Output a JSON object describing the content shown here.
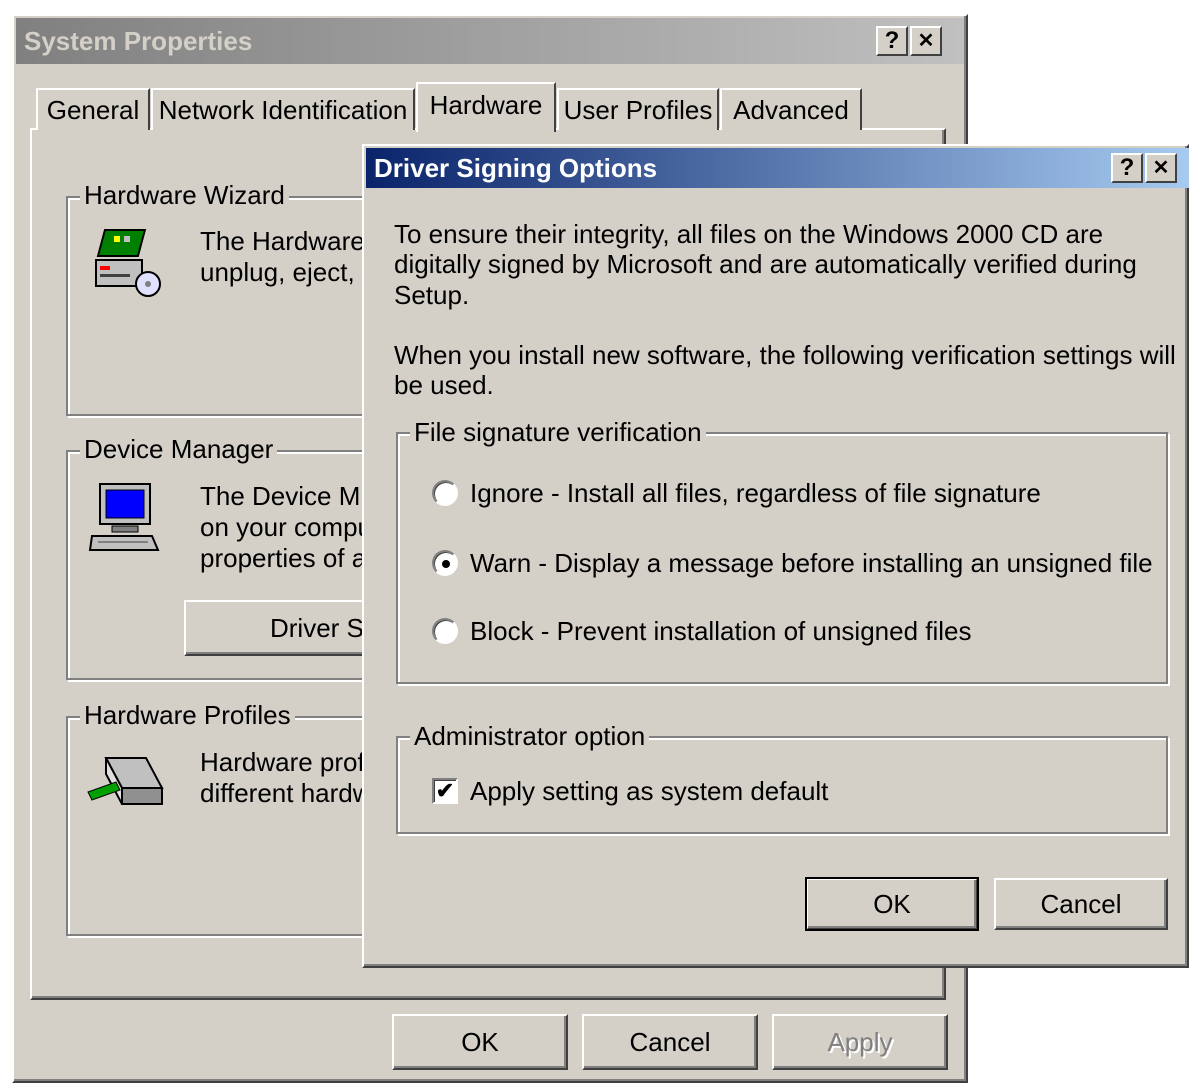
{
  "system_properties": {
    "title": "System Properties",
    "help_button": "?",
    "close_button": "✕",
    "tabs": [
      {
        "label": "General"
      },
      {
        "label": "Network Identification"
      },
      {
        "label": "Hardware"
      },
      {
        "label": "User Profiles"
      },
      {
        "label": "Advanced"
      }
    ],
    "active_tab": "Hardware",
    "hardware_wizard": {
      "legend": "Hardware Wizard",
      "line1": "The Hardware",
      "line2": "unplug, eject, a"
    },
    "device_manager": {
      "legend": "Device Manager",
      "line1": "The Device M",
      "line2": "on your compu",
      "line3": "properties of ar",
      "driver_signing_button": "Driver Si"
    },
    "hardware_profiles": {
      "legend": "Hardware Profiles",
      "line1": "Hardware profi",
      "line2": "different hardw"
    },
    "buttons": {
      "ok": "OK",
      "cancel": "Cancel",
      "apply": "Apply"
    }
  },
  "driver_signing": {
    "title": "Driver Signing Options",
    "help_button": "?",
    "close_button": "✕",
    "intro_line1": "To ensure their integrity, all files on the Windows 2000 CD are",
    "intro_line2": "digitally signed by Microsoft and are automatically verified during",
    "intro_line3": "Setup.",
    "install_line1": "When you install new software, the following verification settings will",
    "install_line2": "be used.",
    "file_sig_legend": "File signature verification",
    "options": [
      {
        "label": "Ignore - Install all files, regardless of file signature",
        "selected": false
      },
      {
        "label": "Warn - Display a message before installing an unsigned file",
        "selected": true
      },
      {
        "label": "Block - Prevent installation of unsigned files",
        "selected": false
      }
    ],
    "admin_legend": "Administrator option",
    "admin_checkbox_label": "Apply setting as system default",
    "admin_checkbox_checked": true,
    "ok": "OK",
    "cancel": "Cancel"
  },
  "colors": {
    "dialog_face": "#d4d0c8",
    "active_title_start": "#0a246a",
    "active_title_end": "#a6caf0",
    "inactive_title": "#808080"
  }
}
